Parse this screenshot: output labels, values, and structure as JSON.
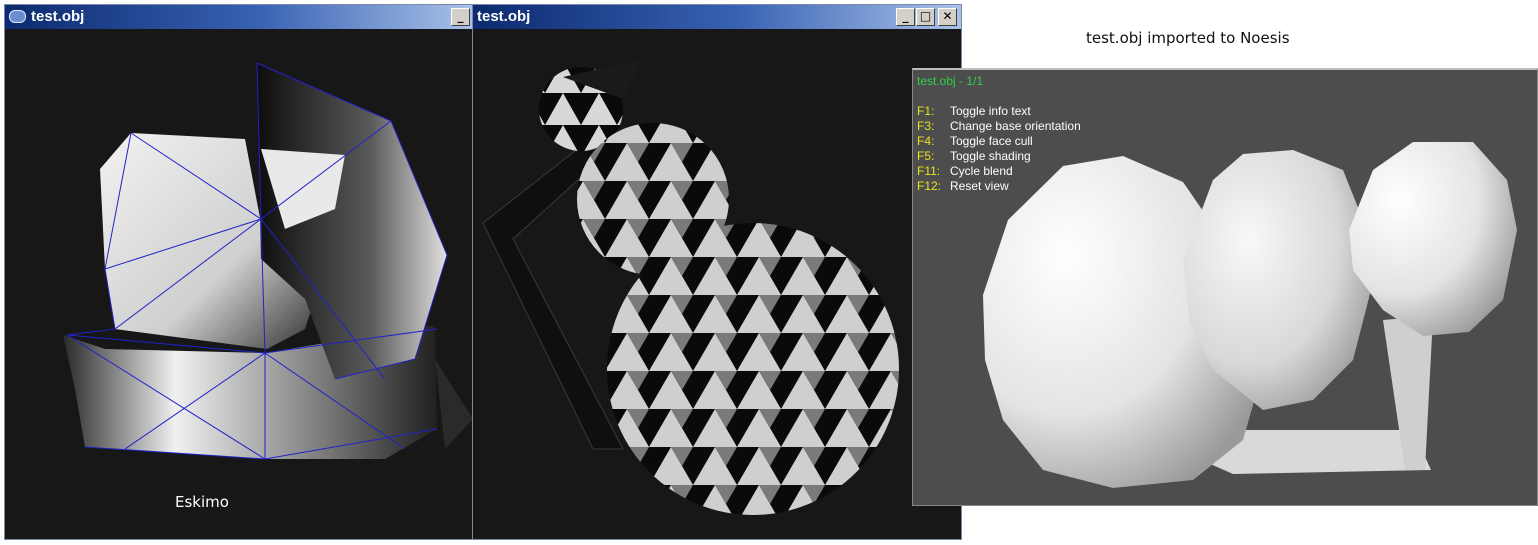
{
  "page_label": "test.obj imported to Noesis",
  "window1": {
    "title": "test.obj",
    "minimize": "_",
    "caption": "Eskimo"
  },
  "window2": {
    "title": "test.obj",
    "minimize": "_",
    "maximize": "□",
    "close": "✕"
  },
  "noesis": {
    "header": "test.obj - 1/1",
    "shortcuts": [
      {
        "key": "F1:",
        "label": "Toggle info text"
      },
      {
        "key": "F3:",
        "label": "Change base orientation"
      },
      {
        "key": "F4:",
        "label": "Toggle face cull"
      },
      {
        "key": "F5:",
        "label": "Toggle shading"
      },
      {
        "key": "F11:",
        "label": "Cycle blend"
      },
      {
        "key": "F12:",
        "label": "Reset view"
      }
    ]
  },
  "colors": {
    "viewport_bg": "#171717",
    "noesis_bg": "#4d4d4d",
    "wireframe": "#1f24c8",
    "info_header": "#2fd14a",
    "info_key": "#e8e31c"
  }
}
